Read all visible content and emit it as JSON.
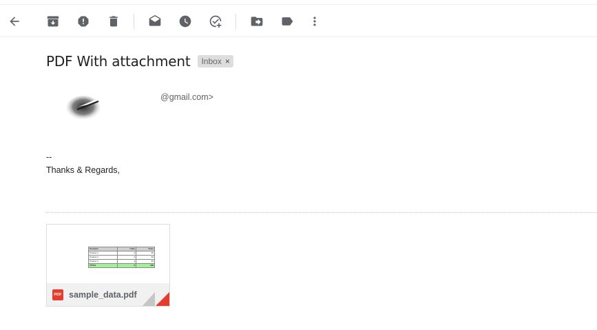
{
  "toolbar": {
    "buttons": [
      {
        "name": "back-icon"
      },
      {
        "name": "archive-icon"
      },
      {
        "name": "report-spam-icon"
      },
      {
        "name": "delete-icon"
      },
      {
        "name": "mark-as-unread-icon"
      },
      {
        "name": "snooze-icon"
      },
      {
        "name": "add-to-tasks-icon"
      },
      {
        "name": "move-to-icon"
      },
      {
        "name": "labels-icon"
      },
      {
        "name": "more-options-icon"
      }
    ]
  },
  "email": {
    "subject": "PDF With attachment",
    "label": "Inbox",
    "label_remove": "×",
    "sender_email": "@gmail.com>",
    "body_lines": [
      "--",
      "Thanks & Regards,"
    ]
  },
  "attachment": {
    "file_name": "sample_data.pdf",
    "type_badge": "PDF",
    "preview_table": {
      "headers": [
        "Products",
        "Units",
        "Price"
      ],
      "rows": [
        [
          "Product 1",
          "2",
          "66"
        ],
        [
          "Product 2",
          "3",
          "66"
        ],
        [
          "Product 3",
          "4",
          "66"
        ]
      ],
      "total": [
        "TOTAL",
        "9",
        "198"
      ]
    }
  },
  "colors": {
    "icon": "#5f6368",
    "chip_bg": "#dddddd",
    "pdf_red": "#e53d2d",
    "total_row": "#a3f19a"
  }
}
